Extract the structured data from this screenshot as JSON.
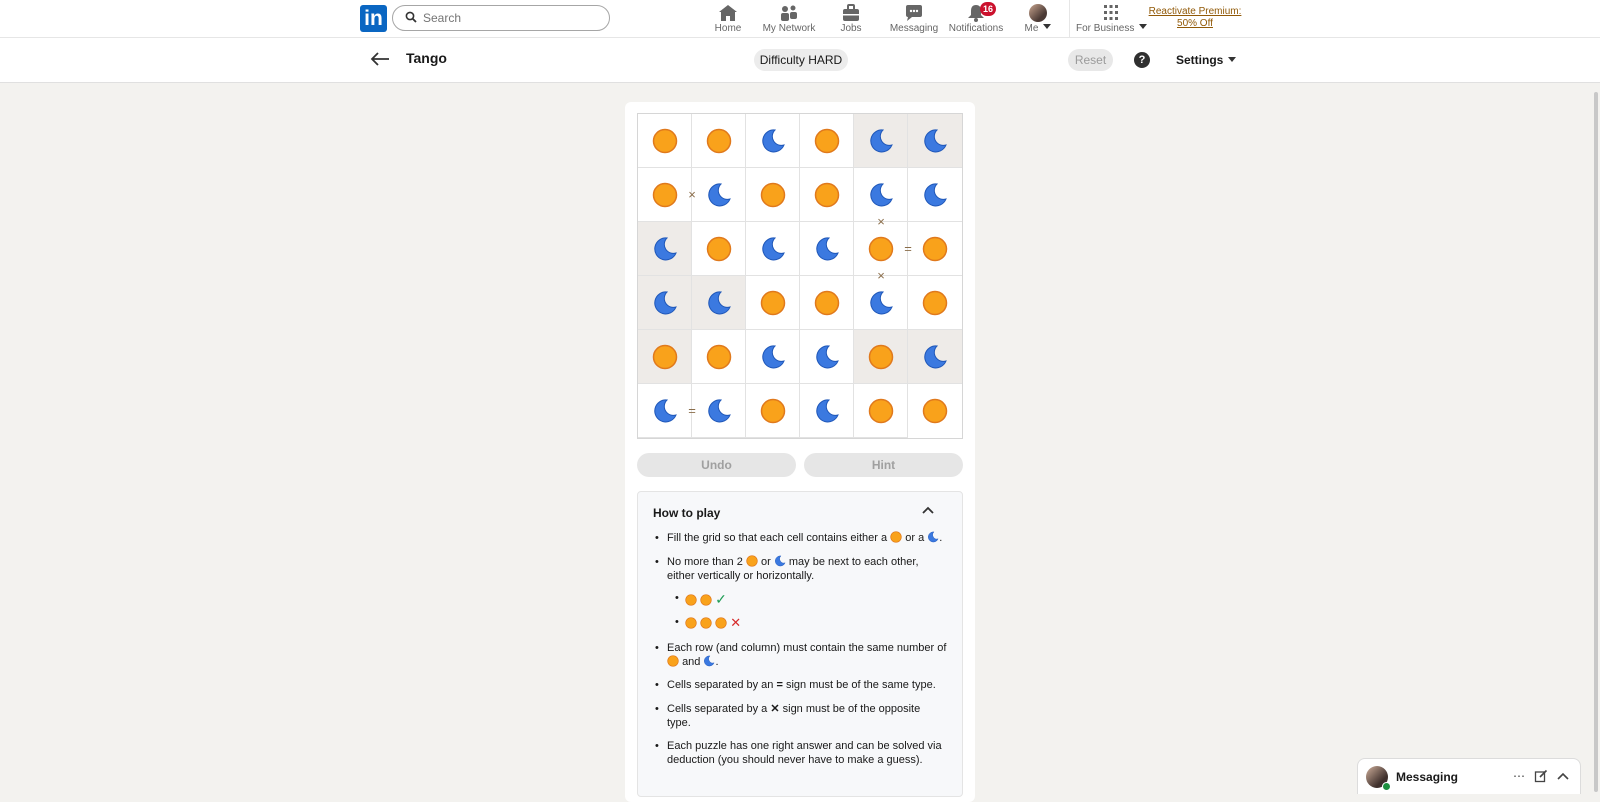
{
  "nav": {
    "logo": "in",
    "search_placeholder": "Search",
    "items": [
      {
        "label": "Home",
        "icon": "home-icon"
      },
      {
        "label": "My Network",
        "icon": "network-icon"
      },
      {
        "label": "Jobs",
        "icon": "briefcase-icon"
      },
      {
        "label": "Messaging",
        "icon": "chat-icon"
      },
      {
        "label": "Notifications",
        "icon": "bell-icon",
        "badge": "16"
      },
      {
        "label": "Me",
        "icon": "avatar"
      },
      {
        "label": "For Business",
        "icon": "grid-icon"
      }
    ],
    "premium_line1": "Reactivate Premium:",
    "premium_line2": "50% Off"
  },
  "subheader": {
    "title": "Tango",
    "difficulty": "Difficulty HARD",
    "reset": "Reset",
    "help": "?",
    "settings": "Settings"
  },
  "game": {
    "grid": [
      [
        "sun",
        "sun",
        "moon",
        "sun",
        "moon",
        "moon"
      ],
      [
        "sun",
        "moon",
        "sun",
        "sun",
        "moon",
        "moon"
      ],
      [
        "moon",
        "sun",
        "moon",
        "moon",
        "sun",
        "sun"
      ],
      [
        "moon",
        "moon",
        "sun",
        "sun",
        "moon",
        "sun"
      ],
      [
        "sun",
        "sun",
        "moon",
        "moon",
        "sun",
        "moon"
      ],
      [
        "moon",
        "moon",
        "sun",
        "moon",
        "sun",
        "sun"
      ]
    ],
    "locked": [
      [
        false,
        false,
        false,
        false,
        true,
        true
      ],
      [
        false,
        false,
        false,
        false,
        false,
        false
      ],
      [
        true,
        false,
        false,
        false,
        false,
        false
      ],
      [
        true,
        true,
        false,
        false,
        false,
        false
      ],
      [
        true,
        false,
        false,
        false,
        true,
        true
      ],
      [
        false,
        false,
        false,
        false,
        false,
        false
      ]
    ],
    "markers": [
      {
        "type": "x",
        "between": [
          [
            1,
            0
          ],
          [
            1,
            1
          ]
        ]
      },
      {
        "type": "x",
        "between": [
          [
            1,
            4
          ],
          [
            2,
            4
          ]
        ]
      },
      {
        "type": "=",
        "between": [
          [
            2,
            4
          ],
          [
            2,
            5
          ]
        ]
      },
      {
        "type": "x",
        "between": [
          [
            2,
            4
          ],
          [
            3,
            4
          ]
        ]
      },
      {
        "type": "=",
        "between": [
          [
            5,
            0
          ],
          [
            5,
            1
          ]
        ]
      }
    ],
    "undo": "Undo",
    "hint": "Hint",
    "colors": {
      "sun": "#f9a21b",
      "sun_border": "#e0791c",
      "moon": "#3b79e0"
    }
  },
  "howto": {
    "title": "How to play",
    "rules": {
      "r1a": "Fill the grid so that each cell contains either a",
      "r1b": "or a",
      "r1c": ".",
      "r2a": "No more than 2",
      "r2b": "or",
      "r2c": "may be next to each other, either vertically or horizontally.",
      "ex_ok": "✓",
      "ex_bad": "✕",
      "r3a": "Each row (and column) must contain the same number of",
      "r3b": "and",
      "r3c": ".",
      "r4a": "Cells separated by an",
      "r4sym": "=",
      "r4b": "sign must be of the same type.",
      "r5a": "Cells separated by a",
      "r5sym": "✕",
      "r5b": "sign must be of the opposite type.",
      "r6": "Each puzzle has one right answer and can be solved via deduction (you should never have to make a guess)."
    }
  },
  "messaging": {
    "label": "Messaging"
  }
}
